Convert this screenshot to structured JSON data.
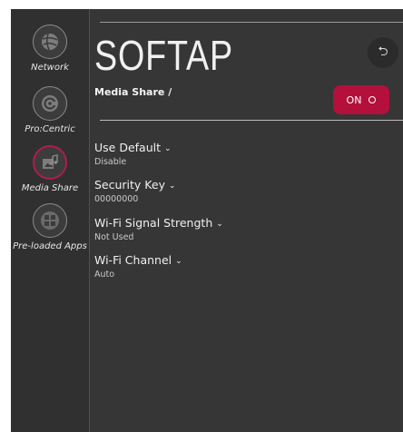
{
  "sidebar": {
    "items": [
      {
        "label": "Network",
        "icon": "globe-icon"
      },
      {
        "label": "Pro:Centric",
        "icon": "procentric-icon"
      },
      {
        "label": "Media Share",
        "icon": "media-share-icon",
        "active": true
      },
      {
        "label": "Pre-loaded Apps",
        "icon": "apps-grid-icon"
      }
    ]
  },
  "header": {
    "title": "SOFTAP",
    "subtitle": "Media Share /",
    "back_icon": "⮌",
    "toggle_label": "ON",
    "toggle_state": true
  },
  "settings": [
    {
      "label": "Use Default",
      "value": "Disable"
    },
    {
      "label": "Security Key",
      "value": "00000000"
    },
    {
      "label": "Wi-Fi Signal Strength",
      "value": "Not Used"
    },
    {
      "label": "Wi-Fi Channel",
      "value": "Auto"
    }
  ],
  "chevron": "⌄",
  "colors": {
    "background": "#363636",
    "sidebar": "#303030",
    "accent": "#b4103c",
    "text": "#f0f0f0"
  }
}
